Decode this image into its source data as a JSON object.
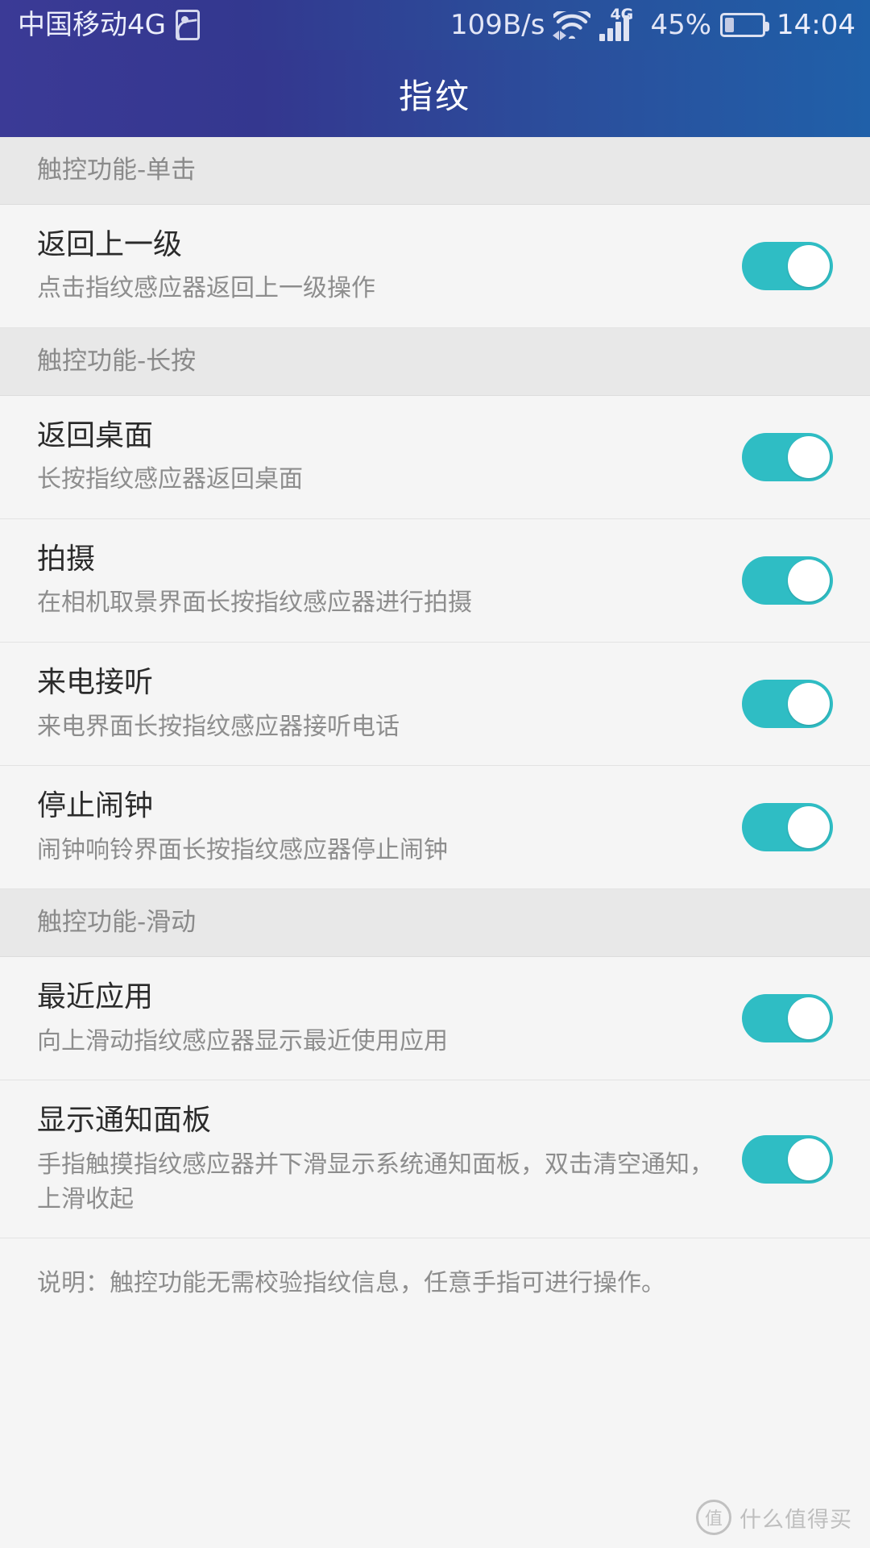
{
  "status_bar": {
    "carrier": "中国移动4G",
    "screenshot_icon": "screenshot-icon",
    "net_speed": "109B/s",
    "wifi_icon": "wifi-icon",
    "signal_label": "4G",
    "signal_icon": "cellular-signal-icon",
    "battery_percent": "45%",
    "battery_icon": "battery-icon",
    "battery_level": 45,
    "clock": "14:04"
  },
  "app_bar": {
    "title": "指纹"
  },
  "sections": [
    {
      "header": "触控功能-单击",
      "rows": [
        {
          "title": "返回上一级",
          "subtitle": "点击指纹感应器返回上一级操作",
          "toggle": "on"
        }
      ]
    },
    {
      "header": "触控功能-长按",
      "rows": [
        {
          "title": "返回桌面",
          "subtitle": "长按指纹感应器返回桌面",
          "toggle": "on"
        },
        {
          "title": "拍摄",
          "subtitle": "在相机取景界面长按指纹感应器进行拍摄",
          "toggle": "on"
        },
        {
          "title": "来电接听",
          "subtitle": "来电界面长按指纹感应器接听电话",
          "toggle": "on"
        },
        {
          "title": "停止闹钟",
          "subtitle": "闹钟响铃界面长按指纹感应器停止闹钟",
          "toggle": "on"
        }
      ]
    },
    {
      "header": "触控功能-滑动",
      "rows": [
        {
          "title": "最近应用",
          "subtitle": "向上滑动指纹感应器显示最近使用应用",
          "toggle": "on"
        },
        {
          "title": "显示通知面板",
          "subtitle": "手指触摸指纹感应器并下滑显示系统通知面板，双击清空通知，上滑收起",
          "toggle": "on"
        }
      ]
    }
  ],
  "footer": {
    "note": "说明：触控功能无需校验指纹信息，任意手指可进行操作。"
  },
  "watermark": {
    "badge": "值",
    "text": "什么值得买"
  },
  "colors": {
    "accent_teal": "#2fbdc4",
    "appbar_start": "#3b3a96",
    "appbar_end": "#2060a9",
    "section_bg": "#e8e8e8",
    "row_bg": "#f5f5f5",
    "title_text": "#2b2b2b",
    "sub_text": "#8d8d8d"
  }
}
